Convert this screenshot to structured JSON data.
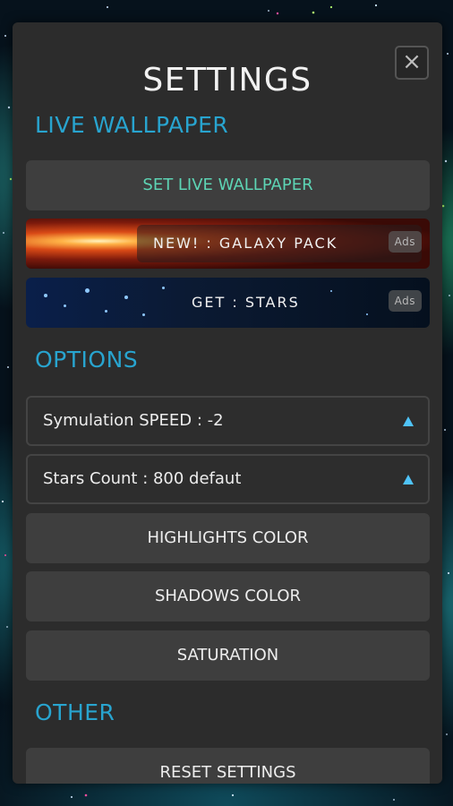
{
  "dialog": {
    "title": "SETTINGS",
    "close_glyph": "×"
  },
  "sections": {
    "live_wallpaper": "LIVE WALLPAPER",
    "options": "OPTIONS",
    "other": "OTHER"
  },
  "buttons": {
    "set_live_wallpaper": "SET LIVE WALLPAPER",
    "highlights_color": "HIGHLIGHTS COLOR",
    "shadows_color": "SHADOWS COLOR",
    "saturation": "SATURATION",
    "reset_settings": "RESET SETTINGS"
  },
  "banners": {
    "galaxy": {
      "text": "NEW! : GALAXY PACK",
      "badge": "Ads"
    },
    "stars": {
      "text": "GET : STARS",
      "badge": "Ads"
    }
  },
  "options": {
    "speed": "Symulation SPEED : -2",
    "stars_count": "Stars Count : 800 defaut"
  },
  "colors": {
    "accent_section": "#28a4cf",
    "accent_button": "#5dd4b4",
    "arrow": "#4fc3f7",
    "panel": "#2c2c2c"
  },
  "icons": {
    "close": "close-icon",
    "dropdown_arrow": "triangle-up-icon"
  }
}
